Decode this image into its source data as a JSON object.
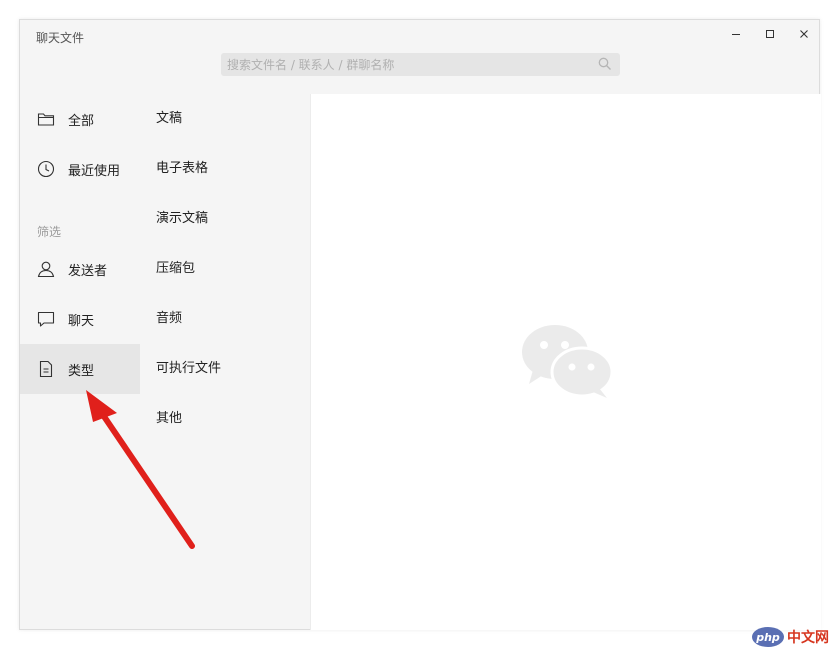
{
  "window": {
    "title": "聊天文件"
  },
  "window_controls": {
    "minimize": "–",
    "maximize": "□",
    "close": "✕"
  },
  "search": {
    "placeholder": "搜索文件名 / 联系人 / 群聊名称",
    "value": ""
  },
  "sidebar": {
    "items": [
      {
        "label": "全部",
        "icon": "folder-icon"
      },
      {
        "label": "最近使用",
        "icon": "clock-icon"
      },
      {
        "label": "发送者",
        "icon": "person-icon"
      },
      {
        "label": "聊天",
        "icon": "chat-bubble-icon"
      },
      {
        "label": "类型",
        "icon": "document-icon",
        "active": true
      }
    ],
    "filter_label": "筛选"
  },
  "types": {
    "items": [
      "文稿",
      "电子表格",
      "演示文稿",
      "压缩包",
      "音频",
      "可执行文件",
      "其他"
    ]
  },
  "watermark": {
    "badge": "php",
    "text": "中文网"
  },
  "colors": {
    "arrow": "#e0201b",
    "sidebar_bg": "#f5f5f5",
    "active_bg": "#e6e6e6",
    "logo": "#ebebeb"
  }
}
